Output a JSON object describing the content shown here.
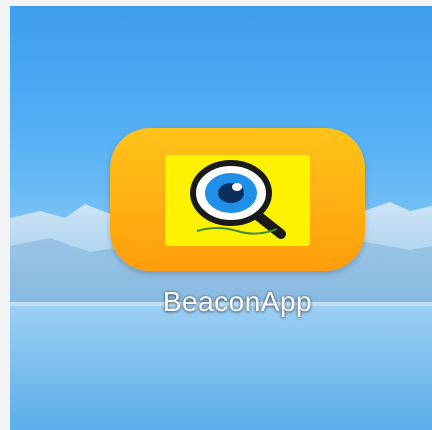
{
  "home_screen": {
    "app": {
      "label": "BeaconApp",
      "icon": "magnifier-eye-logo-icon",
      "colors": {
        "tile": "#ffb012",
        "logo_background": "#fff200",
        "eye": "#1f8fe8"
      }
    }
  }
}
